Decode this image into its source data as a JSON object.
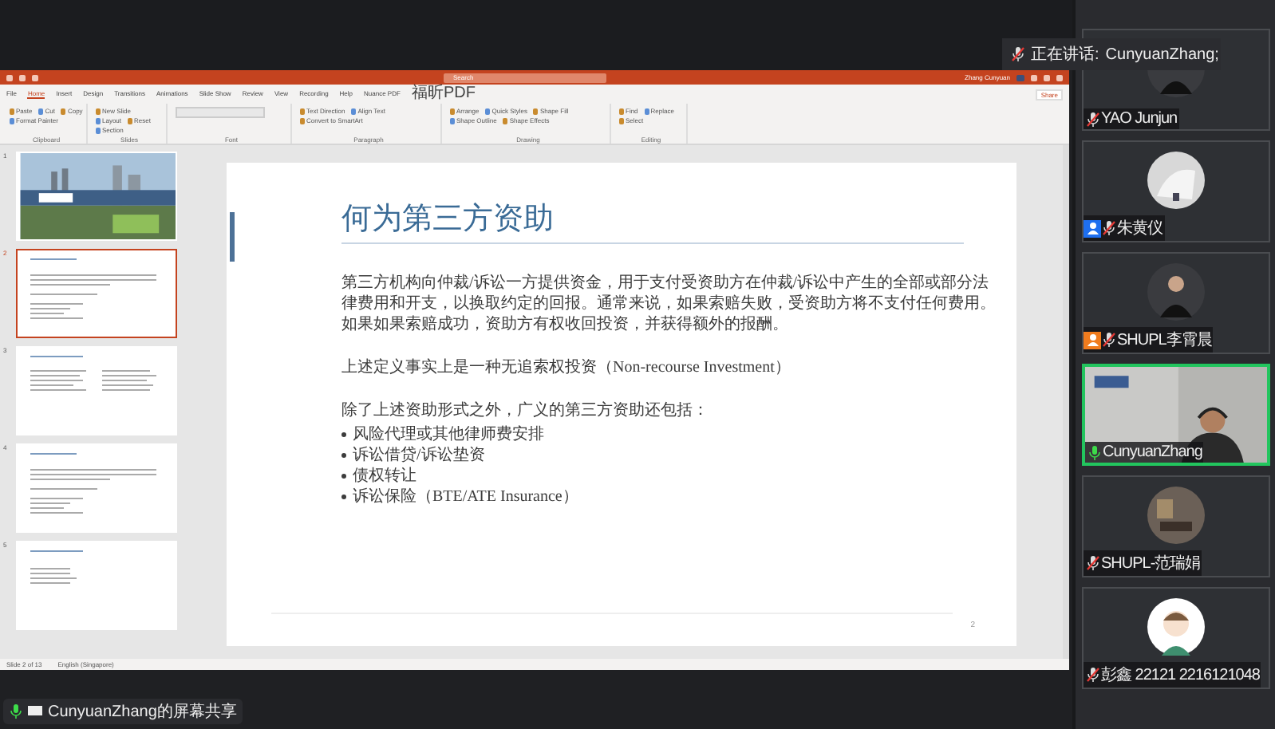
{
  "speaking": {
    "label": "正在讲话:",
    "name": "CunyuanZhang;"
  },
  "powerpoint": {
    "search": "Search",
    "user": "Zhang Cunyuan",
    "share": "Share",
    "tabs": [
      {
        "label": "File",
        "selected": false
      },
      {
        "label": "Home",
        "selected": true
      },
      {
        "label": "Insert",
        "selected": false
      },
      {
        "label": "Design",
        "selected": false
      },
      {
        "label": "Transitions",
        "selected": false
      },
      {
        "label": "Animations",
        "selected": false
      },
      {
        "label": "Slide Show",
        "selected": false
      },
      {
        "label": "Review",
        "selected": false
      },
      {
        "label": "View",
        "selected": false
      },
      {
        "label": "Recording",
        "selected": false
      },
      {
        "label": "Help",
        "selected": false
      },
      {
        "label": "Nuance PDF",
        "selected": false
      },
      {
        "label": "福昕PDF",
        "selected": false
      }
    ],
    "groups": [
      {
        "label": "Clipboard",
        "commands": [
          "Paste",
          "Cut",
          "Copy",
          "Format Painter"
        ]
      },
      {
        "label": "Slides",
        "commands": [
          "New Slide",
          "Layout",
          "Reset",
          "Section"
        ]
      },
      {
        "label": "Font"
      },
      {
        "label": "Paragraph",
        "commands": [
          "Text Direction",
          "Align Text",
          "Convert to SmartArt"
        ]
      },
      {
        "label": "Drawing",
        "commands": [
          "Arrange",
          "Quick Styles",
          "Shape Fill",
          "Shape Outline",
          "Shape Effects"
        ]
      },
      {
        "label": "Editing",
        "commands": [
          "Find",
          "Replace",
          "Select"
        ]
      }
    ],
    "thumbnails": [
      {
        "number": "1",
        "kind": "picture",
        "selected": false
      },
      {
        "number": "2",
        "kind": "text",
        "selected": true
      },
      {
        "number": "3",
        "kind": "columns",
        "selected": false
      },
      {
        "number": "4",
        "kind": "text",
        "selected": false
      },
      {
        "number": "5",
        "kind": "list",
        "selected": false
      }
    ],
    "slide": {
      "title": "何为第三方资助",
      "paragraphs": [
        "第三方机构向仲裁/诉讼一方提供资金，用于支付受资助方在仲裁/诉讼中产生的全部或部分法律费用和开支，以换取约定的回报。通常来说，如果索赔失败，受资助方将不支付任何费用。如果如果索赔成功，资助方有权收回投资，并获得额外的报酬。",
        "上述定义事实上是一种无追索权投资（Non-recourse Investment）",
        "除了上述资助形式之外，广义的第三方资助还包括："
      ],
      "bullets": [
        "风险代理或其他律师费安排",
        "诉讼借贷/诉讼垫资",
        "债权转让",
        "诉讼保险（BTE/ATE Insurance）"
      ],
      "page": "2"
    },
    "status": {
      "slide": "Slide 2 of 13",
      "language": "English (Singapore)"
    }
  },
  "share_label": "CunyuanZhang的屏幕共享",
  "participants": [
    {
      "name": "YAO Junjun",
      "muted": true,
      "active": false,
      "kind": "suit"
    },
    {
      "name": "朱黄仪",
      "muted": true,
      "active": false,
      "kind": "white",
      "color": "#1e6ff0"
    },
    {
      "name": "SHUPL李霄晨",
      "muted": true,
      "active": false,
      "kind": "suit",
      "color": "#f07c1e"
    },
    {
      "name": "CunyuanZhang",
      "muted": false,
      "active": true,
      "kind": "video"
    },
    {
      "name": "SHUPL-范瑞娟",
      "muted": true,
      "active": false,
      "kind": "room"
    },
    {
      "name": "彭鑫 22121 2216121048",
      "muted": true,
      "active": false,
      "kind": "cartoon"
    }
  ]
}
